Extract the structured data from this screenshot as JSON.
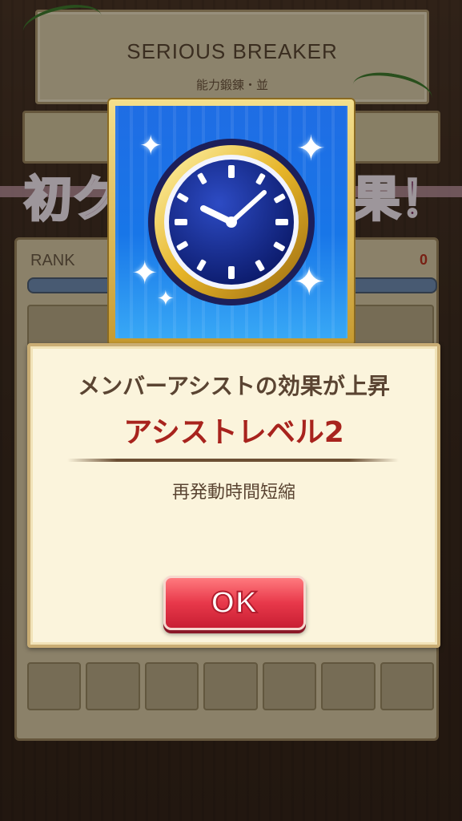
{
  "header": {
    "title": "SERIOUS BREAKER",
    "subtitle": "能力鍛錬・並"
  },
  "banner": {
    "left_text": "初ク",
    "right_text": "果！"
  },
  "rank": {
    "label": "RANK",
    "value": "0"
  },
  "dialog": {
    "line1": "メンバーアシストの効果が上昇",
    "line2": "アシストレベル2",
    "line3": "再発動時間短縮",
    "ok_label": "OK"
  },
  "icon": {
    "name": "clock-icon"
  },
  "colors": {
    "dialog_bg": "#fbf4dc",
    "accent_red": "#a8231d",
    "ok_button": "#e8384a",
    "icon_bg": "#1876e8"
  }
}
